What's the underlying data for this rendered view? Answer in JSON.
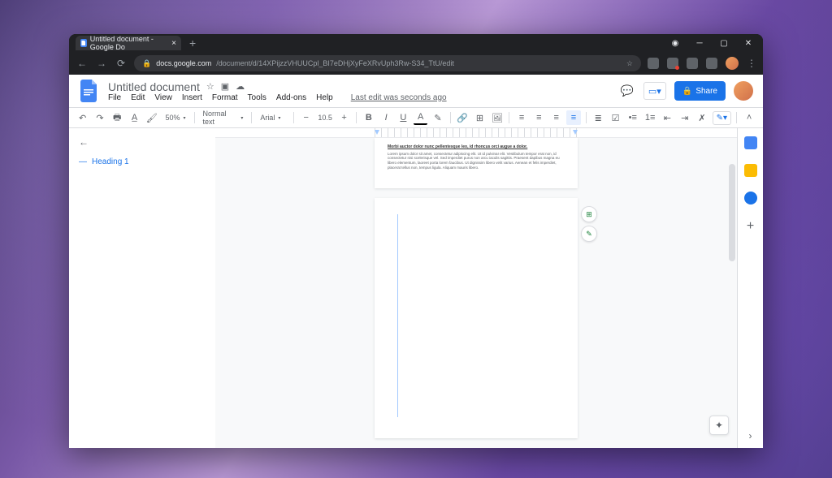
{
  "browser": {
    "tab_title": "Untitled document - Google Do",
    "url_domain": "docs.google.com",
    "url_path": "/document/d/14XPijzzVHUUCpl_BI7eDHjXyFeXRvUph3Rw-S34_TtU/edit"
  },
  "docs": {
    "title": "Untitled document",
    "menubar": [
      "File",
      "Edit",
      "View",
      "Insert",
      "Format",
      "Tools",
      "Add-ons",
      "Help"
    ],
    "last_edit": "Last edit was seconds ago",
    "share_label": "Share"
  },
  "toolbar": {
    "zoom": "50%",
    "style": "Normal text",
    "font": "Arial",
    "size": "10.5"
  },
  "outline": {
    "items": [
      "Heading 1"
    ]
  },
  "page1": {
    "heading_underline": "Morbi auctor dolor nunc pellentesque leo, id rhoncus orci augue a dolor.",
    "body": "Lorem ipsum dolor sit amet, consectetur adipiscing elit. Ut id pulvinar elit. Vestibulum tempor erat non, id consectetur nisi scelerisque vel. Sed imperdiet purus non arcu iaculis sagittis. Praesent dapibus magna eu libero elementum, laoreet porta lorem faucibus. Ut dignissim libero velit varius. Aenean et felis imperdiet, placerat tellus non, tempus ligula. Aliquam mauris libero."
  }
}
